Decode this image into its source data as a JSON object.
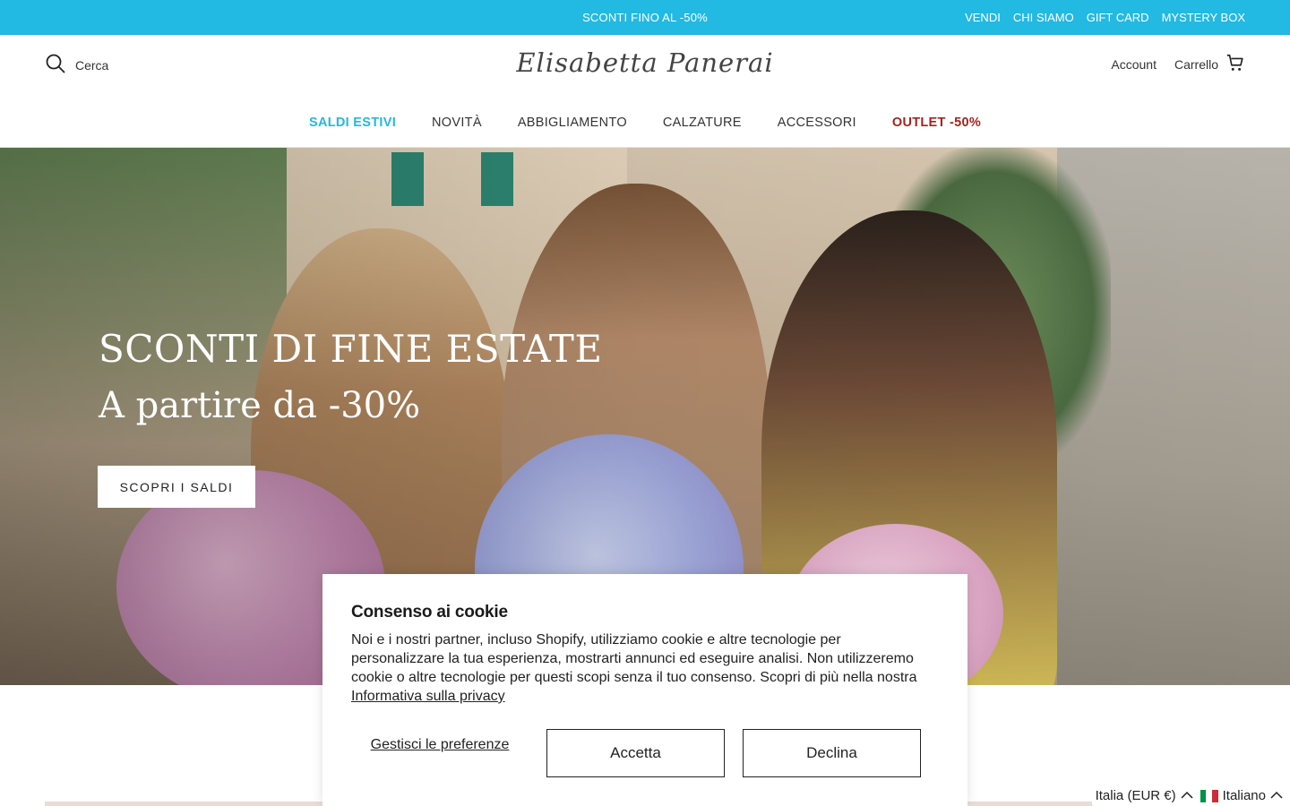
{
  "topbar": {
    "promo": "SCONTI FINO AL -50%",
    "links": [
      "VENDI",
      "CHI SIAMO",
      "GIFT CARD",
      "MYSTERY BOX"
    ]
  },
  "header": {
    "search_label": "Cerca",
    "logo_text": "Elisabetta Panerai",
    "account_label": "Account",
    "cart_label": "Carrello"
  },
  "nav": {
    "items": [
      "SALDI ESTIVI",
      "NOVITÀ",
      "ABBIGLIAMENTO",
      "CALZATURE",
      "ACCESSORI",
      "OUTLET -50%"
    ]
  },
  "hero": {
    "title": "SCONTI DI FINE ESTATE",
    "subtitle": "A partire da -30%",
    "button": "SCOPRI I SALDI"
  },
  "cookie": {
    "title": "Consenso ai cookie",
    "body": "Noi e i nostri partner, incluso Shopify, utilizziamo cookie e altre tecnologie per personalizzare la tua esperienza, mostrarti annunci ed eseguire analisi. Non utilizzeremo cookie o altre tecnologie per questi scopi senza il tuo consenso. Scopri di più nella nostra ",
    "privacy_link": "Informativa sulla privacy",
    "manage": "Gestisci le preferenze",
    "accept": "Accetta",
    "decline": "Declina"
  },
  "locale": {
    "country": "Italia (EUR €)",
    "language": "Italiano"
  },
  "colors": {
    "accent": "#22b9e3",
    "outlet": "#a5231b"
  }
}
